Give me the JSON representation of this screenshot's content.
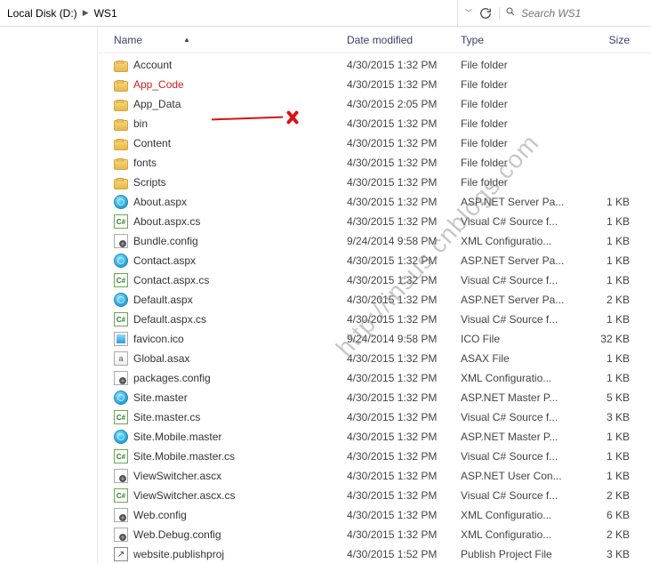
{
  "breadcrumb": {
    "root": "Local Disk (D:)",
    "current": "WS1"
  },
  "search": {
    "placeholder": "Search WS1"
  },
  "columns": {
    "name": "Name",
    "date": "Date modified",
    "type": "Type",
    "size": "Size"
  },
  "watermark_text": "http://insus.cnblogs.com",
  "rows": [
    {
      "icon": "folder",
      "name": "Account",
      "date": "4/30/2015 1:32 PM",
      "type": "File folder",
      "size": ""
    },
    {
      "icon": "folder",
      "name": "App_Code",
      "date": "4/30/2015 1:32 PM",
      "type": "File folder",
      "size": "",
      "struck": true
    },
    {
      "icon": "folder",
      "name": "App_Data",
      "date": "4/30/2015 2:05 PM",
      "type": "File folder",
      "size": ""
    },
    {
      "icon": "folder",
      "name": "bin",
      "date": "4/30/2015 1:32 PM",
      "type": "File folder",
      "size": ""
    },
    {
      "icon": "folder",
      "name": "Content",
      "date": "4/30/2015 1:32 PM",
      "type": "File folder",
      "size": ""
    },
    {
      "icon": "folder",
      "name": "fonts",
      "date": "4/30/2015 1:32 PM",
      "type": "File folder",
      "size": ""
    },
    {
      "icon": "folder",
      "name": "Scripts",
      "date": "4/30/2015 1:32 PM",
      "type": "File folder",
      "size": ""
    },
    {
      "icon": "globe",
      "name": "About.aspx",
      "date": "4/30/2015 1:32 PM",
      "type": "ASP.NET Server Pa...",
      "size": "1 KB"
    },
    {
      "icon": "cs",
      "name": "About.aspx.cs",
      "date": "4/30/2015 1:32 PM",
      "type": "Visual C# Source f...",
      "size": "1 KB"
    },
    {
      "icon": "config",
      "name": "Bundle.config",
      "date": "9/24/2014 9:58 PM",
      "type": "XML Configuratio...",
      "size": "1 KB"
    },
    {
      "icon": "globe",
      "name": "Contact.aspx",
      "date": "4/30/2015 1:32 PM",
      "type": "ASP.NET Server Pa...",
      "size": "1 KB"
    },
    {
      "icon": "cs",
      "name": "Contact.aspx.cs",
      "date": "4/30/2015 1:32 PM",
      "type": "Visual C# Source f...",
      "size": "1 KB"
    },
    {
      "icon": "globe",
      "name": "Default.aspx",
      "date": "4/30/2015 1:32 PM",
      "type": "ASP.NET Server Pa...",
      "size": "2 KB"
    },
    {
      "icon": "cs",
      "name": "Default.aspx.cs",
      "date": "4/30/2015 1:32 PM",
      "type": "Visual C# Source f...",
      "size": "1 KB"
    },
    {
      "icon": "ico",
      "name": "favicon.ico",
      "date": "9/24/2014 9:58 PM",
      "type": "ICO File",
      "size": "32 KB"
    },
    {
      "icon": "asax",
      "name": "Global.asax",
      "date": "4/30/2015 1:32 PM",
      "type": "ASAX File",
      "size": "1 KB"
    },
    {
      "icon": "config",
      "name": "packages.config",
      "date": "4/30/2015 1:32 PM",
      "type": "XML Configuratio...",
      "size": "1 KB"
    },
    {
      "icon": "globe",
      "name": "Site.master",
      "date": "4/30/2015 1:32 PM",
      "type": "ASP.NET Master P...",
      "size": "5 KB"
    },
    {
      "icon": "cs",
      "name": "Site.master.cs",
      "date": "4/30/2015 1:32 PM",
      "type": "Visual C# Source f...",
      "size": "3 KB"
    },
    {
      "icon": "globe",
      "name": "Site.Mobile.master",
      "date": "4/30/2015 1:32 PM",
      "type": "ASP.NET Master P...",
      "size": "1 KB"
    },
    {
      "icon": "cs",
      "name": "Site.Mobile.master.cs",
      "date": "4/30/2015 1:32 PM",
      "type": "Visual C# Source f...",
      "size": "1 KB"
    },
    {
      "icon": "config",
      "name": "ViewSwitcher.ascx",
      "date": "4/30/2015 1:32 PM",
      "type": "ASP.NET User Con...",
      "size": "1 KB"
    },
    {
      "icon": "cs",
      "name": "ViewSwitcher.ascx.cs",
      "date": "4/30/2015 1:32 PM",
      "type": "Visual C# Source f...",
      "size": "2 KB"
    },
    {
      "icon": "config",
      "name": "Web.config",
      "date": "4/30/2015 1:32 PM",
      "type": "XML Configuratio...",
      "size": "6 KB"
    },
    {
      "icon": "config",
      "name": "Web.Debug.config",
      "date": "4/30/2015 1:32 PM",
      "type": "XML Configuratio...",
      "size": "2 KB"
    },
    {
      "icon": "publish",
      "name": "website.publishproj",
      "date": "4/30/2015 1:52 PM",
      "type": "Publish Project File",
      "size": "3 KB"
    }
  ]
}
